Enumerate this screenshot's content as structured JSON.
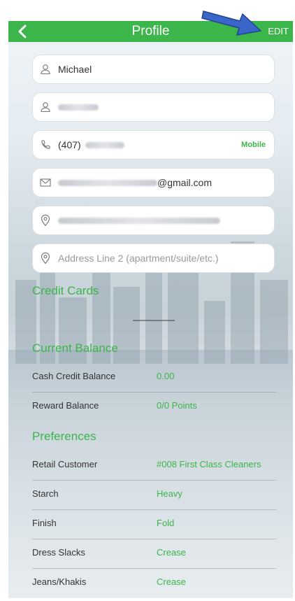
{
  "header": {
    "title": "Profile",
    "edit_label": "EDIT",
    "back_icon": "chevron-left-icon"
  },
  "annotation": {
    "icon": "blue-arrow-icon",
    "color": "#3a66c9"
  },
  "fields": {
    "first_name": "Michael",
    "phone_prefix": "(407)",
    "phone_type": "Mobile",
    "email_suffix": "@gmail.com",
    "address2_placeholder": "Address Line 2 (apartment/suite/etc.)"
  },
  "sections": {
    "credit_cards": "Credit Cards",
    "credit_cards_empty": "--------------------",
    "current_balance": "Current Balance",
    "preferences": "Preferences"
  },
  "balance_rows": [
    {
      "label": "Cash Credit Balance",
      "value": "0.00"
    },
    {
      "label": "Reward Balance",
      "value": "0/0 Points"
    }
  ],
  "preference_rows": [
    {
      "label": "Retail Customer",
      "value": "#008 First Class Cleaners"
    },
    {
      "label": "Starch",
      "value": "Heavy"
    },
    {
      "label": "Finish",
      "value": "Fold"
    },
    {
      "label": "Dress Slacks",
      "value": "Crease"
    },
    {
      "label": "Jeans/Khakis",
      "value": "Crease"
    }
  ],
  "colors": {
    "accent": "#3cb54a",
    "header_bg": "#3cb54a"
  }
}
